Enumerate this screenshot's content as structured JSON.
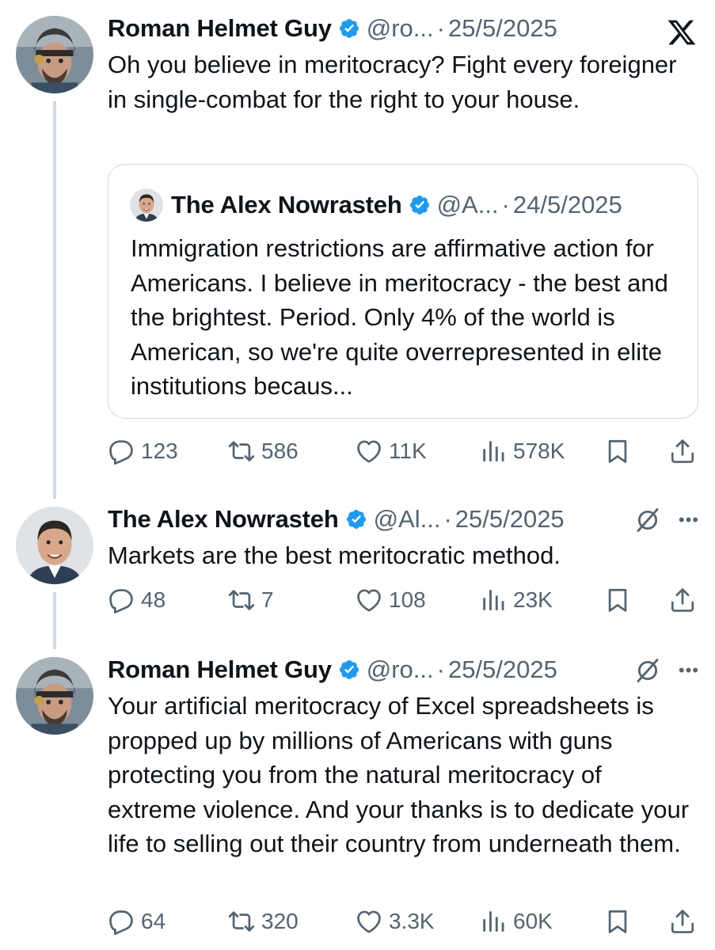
{
  "tweets": [
    {
      "author": "Roman Helmet Guy",
      "handle": "@ro...",
      "date": "25/5/2025",
      "text": "Oh you believe in meritocracy? Fight every foreigner in single-combat for the right to your house.",
      "quote": {
        "author": "The Alex Nowrasteh",
        "handle": "@A...",
        "date": "24/5/2025",
        "text": "Immigration restrictions are affirmative action for Americans. I believe in meritocracy - the best and the brightest. Period. Only 4% of the world is American, so we're quite overrepresented in elite institutions becaus..."
      },
      "replies": "123",
      "reposts": "586",
      "likes": "11K",
      "views": "578K"
    },
    {
      "author": "The Alex Nowrasteh",
      "handle": "@Al...",
      "date": "25/5/2025",
      "text": "Markets are the best meritocratic method.",
      "replies": "48",
      "reposts": "7",
      "likes": "108",
      "views": "23K"
    },
    {
      "author": "Roman Helmet Guy",
      "handle": "@ro...",
      "date": "25/5/2025",
      "text": "Your artificial meritocracy of Excel spreadsheets is propped up by millions of Americans with guns protecting you from the natural meritocracy of extreme violence. And your thanks is to dedicate your life to selling out their country from underneath them.",
      "replies": "64",
      "reposts": "320",
      "likes": "3.3K",
      "views": "60K"
    }
  ],
  "separator": "·",
  "icons": {
    "verified": "verified-badge-icon",
    "x_logo": "x-logo-icon",
    "grok": "grok-icon",
    "more": "more-icon",
    "reply": "reply-icon",
    "repost": "repost-icon",
    "like": "like-icon",
    "views": "views-icon",
    "bookmark": "bookmark-icon",
    "share": "share-icon"
  },
  "colors": {
    "text": "#0f1419",
    "secondary": "#536471",
    "verified": "#1d9bf0",
    "border": "#cfd9de"
  }
}
